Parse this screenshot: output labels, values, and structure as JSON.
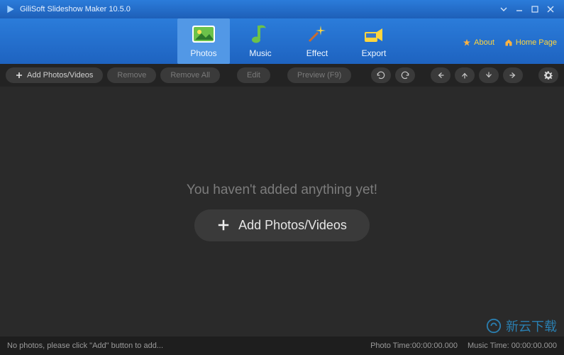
{
  "title": "GiliSoft Slideshow Maker 10.5.0",
  "tabs": [
    {
      "key": "photos",
      "label": "Photos",
      "active": true
    },
    {
      "key": "music",
      "label": "Music"
    },
    {
      "key": "effect",
      "label": "Effect"
    },
    {
      "key": "export",
      "label": "Export"
    }
  ],
  "header_links": {
    "about": "About",
    "home": "Home Page"
  },
  "toolbar": {
    "add": "Add Photos/Videos",
    "remove": "Remove",
    "remove_all": "Remove All",
    "edit": "Edit",
    "preview": "Preview (F9)"
  },
  "empty": {
    "message": "You haven't added anything yet!",
    "cta": "Add Photos/Videos"
  },
  "status": {
    "hint": "No photos, please click \"Add\" button to add...",
    "photo_time_label": "Photo Time:",
    "photo_time": "00:00:00.000",
    "music_time_label": "Music Time:",
    "music_time": "00:00:00.000"
  },
  "watermark": "新云下载"
}
